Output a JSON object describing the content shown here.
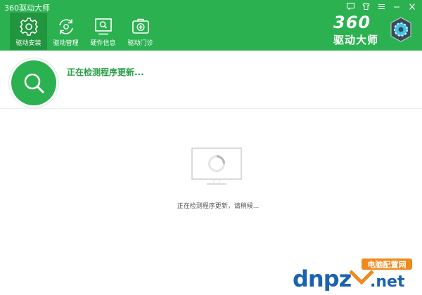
{
  "app": {
    "title": "360驱动大师"
  },
  "window_controls": [
    {
      "name": "feedback-icon"
    },
    {
      "name": "skin-icon"
    },
    {
      "name": "menu-icon"
    },
    {
      "name": "minimize-icon"
    },
    {
      "name": "close-icon"
    }
  ],
  "nav": {
    "items": [
      {
        "label": "驱动安装",
        "icon": "gear-icon",
        "active": true
      },
      {
        "label": "驱动管理",
        "icon": "refresh-icon",
        "active": false
      },
      {
        "label": "硬件信息",
        "icon": "monitor-search-icon",
        "active": false
      },
      {
        "label": "驱动门诊",
        "icon": "medical-box-icon",
        "active": false
      }
    ]
  },
  "brand": {
    "number": "360",
    "name": "驱动大师"
  },
  "status": {
    "headline": "正在检测程序更新...",
    "icon": "search-icon"
  },
  "main": {
    "waiting_text": "正在检测程序更新，请稍候..."
  },
  "watermark": {
    "text": "dnpz.net",
    "badge": "电脑配置网"
  },
  "colors": {
    "accent": "#2bb150",
    "accent_dark": "#22953f",
    "status_text": "#2a9e48"
  }
}
